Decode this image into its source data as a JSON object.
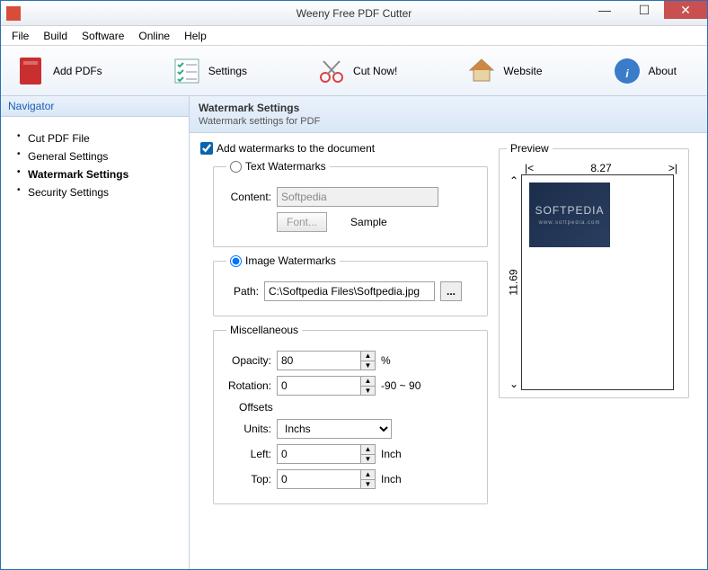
{
  "window": {
    "title": "Weeny Free PDF Cutter"
  },
  "menu": [
    "File",
    "Build",
    "Software",
    "Online",
    "Help"
  ],
  "toolbar": [
    {
      "label": "Add PDFs",
      "name": "add-pdfs"
    },
    {
      "label": "Settings",
      "name": "settings"
    },
    {
      "label": "Cut Now!",
      "name": "cut-now"
    },
    {
      "label": "Website",
      "name": "website"
    },
    {
      "label": "About",
      "name": "about"
    }
  ],
  "sidebar": {
    "header": "Navigator",
    "items": [
      "Cut PDF File",
      "General Settings",
      "Watermark Settings",
      "Security Settings"
    ],
    "active_index": 2
  },
  "main": {
    "title": "Watermark Settings",
    "subtitle": "Watermark settings for PDF",
    "add_watermarks_label": "Add watermarks to the document",
    "add_watermarks_checked": true,
    "text_group": {
      "legend": "Text Watermarks",
      "content_label": "Content:",
      "content_value": "Softpedia",
      "font_btn": "Font...",
      "sample_label": "Sample"
    },
    "image_group": {
      "legend": "Image Watermarks",
      "path_label": "Path:",
      "path_value": "C:\\Softpedia Files\\Softpedia.jpg"
    },
    "misc": {
      "legend": "Miscellaneous",
      "opacity_label": "Opacity:",
      "opacity_value": "80",
      "opacity_unit": "%",
      "rotation_label": "Rotation:",
      "rotation_value": "0",
      "rotation_range": "-90 ~ 90",
      "offsets_legend": "Offsets",
      "units_label": "Units:",
      "units_value": "Inchs",
      "left_label": "Left:",
      "left_value": "0",
      "top_label": "Top:",
      "top_value": "0",
      "inch": "Inch"
    },
    "preview": {
      "legend": "Preview",
      "width": "8.27",
      "height": "11.69",
      "wm_text": "SOFTPEDIA",
      "wm_sub": "www.softpedia.com"
    }
  }
}
